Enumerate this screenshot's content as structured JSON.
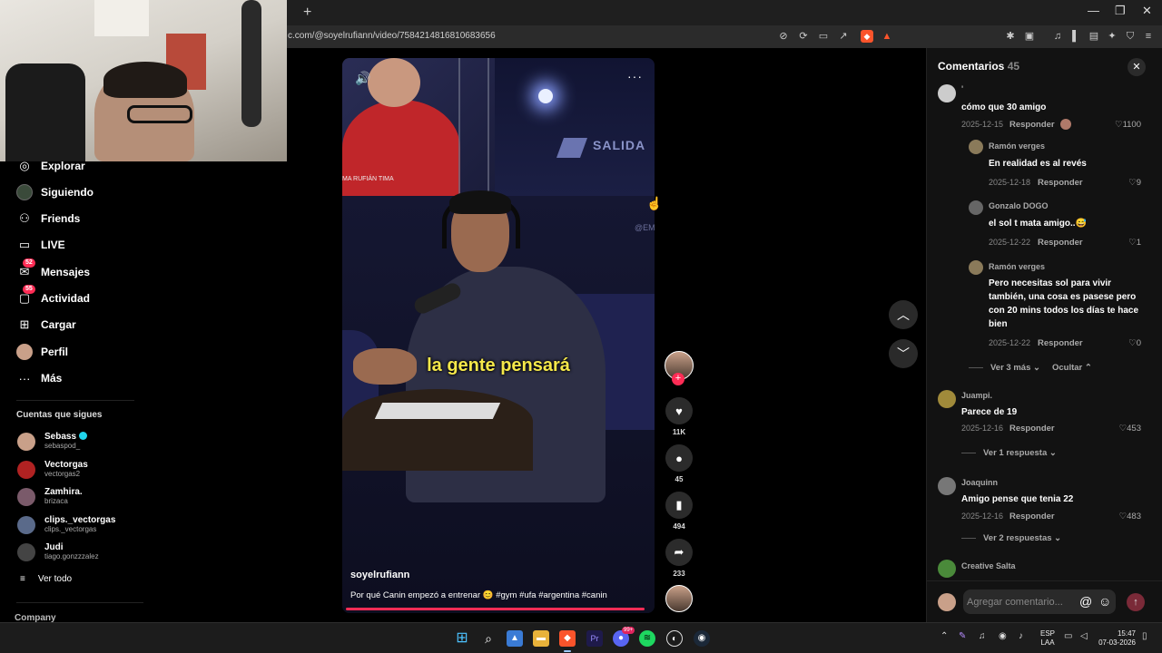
{
  "browser": {
    "url": "c.com/@soyelrufiann/video/7584214816810683656",
    "new_tab": "+",
    "window_controls": [
      "—",
      "❐",
      "✕"
    ]
  },
  "nav": {
    "items": [
      {
        "label": "Explorar",
        "icon": "compass-icon",
        "glyph": "◎"
      },
      {
        "label": "Siguiendo",
        "icon": "following-avatar-icon",
        "glyph": "●"
      },
      {
        "label": "Friends",
        "icon": "friends-icon",
        "glyph": "⚇"
      },
      {
        "label": "LIVE",
        "icon": "live-tv-icon",
        "glyph": "▭"
      },
      {
        "label": "Mensajes",
        "icon": "messages-icon",
        "glyph": "✉",
        "badge": "52"
      },
      {
        "label": "Actividad",
        "icon": "activity-icon",
        "glyph": "▢",
        "badge": "55"
      },
      {
        "label": "Cargar",
        "icon": "upload-icon",
        "glyph": "⊞"
      },
      {
        "label": "Perfil",
        "icon": "profile-avatar-icon",
        "glyph": "●"
      },
      {
        "label": "Más",
        "icon": "more-dots-icon",
        "glyph": "···"
      }
    ],
    "following_title": "Cuentas que sigues",
    "following": [
      {
        "name": "Sebass",
        "handle": "sebaspod_",
        "verified": true,
        "color": "#c9a089"
      },
      {
        "name": "Vectorgas",
        "handle": "vectorgas2",
        "verified": false,
        "color": "#b02222"
      },
      {
        "name": "Zamhira.",
        "handle": "brizaca",
        "verified": false,
        "color": "#7a5a6a"
      },
      {
        "name": "clips._vectorgas",
        "handle": "clips._vectorgas",
        "verified": false,
        "color": "#5a6a8a"
      },
      {
        "name": "Judi",
        "handle": "tiago.gonzzzalez",
        "verified": false,
        "color": "#444444"
      }
    ],
    "see_all": "Ver todo",
    "company": "Company"
  },
  "video": {
    "caption": "la gente pensará",
    "author": "soyelrufiann",
    "description": "Por qué Canin empezó a entrenar 😊 #gym #ufa #argentina #canin",
    "overlay_brand": "SALIDA",
    "overlay_watermark": "@EM",
    "overlay_small": "MA RUFIÁN TIMA",
    "handle_overlay": "soyelrufian",
    "mute_icon": "🔊",
    "more_icon": "···",
    "progress": 0.98
  },
  "actions": {
    "likes": "11K",
    "comments": "45",
    "saves": "494",
    "shares": "233",
    "follow_plus": "+"
  },
  "comments_panel": {
    "title": "Comentarios",
    "count": "45",
    "close": "✕",
    "comments": [
      {
        "user": "'",
        "text": "cómo que 30 amigo",
        "date": "2025-12-15",
        "reply": "Responder",
        "likes": "1100"
      },
      {
        "user": "Ramón verges",
        "text": "En realidad es al revés",
        "date": "2025-12-18",
        "reply": "Responder",
        "likes": "9"
      },
      {
        "user": "Gonzalo DOGO",
        "text": "el sol t mata amigo..😅",
        "date": "2025-12-22",
        "reply": "Responder",
        "likes": "1"
      },
      {
        "user": "Ramón verges",
        "text": "Pero necesitas sol para vivir también, una cosa es pasese pero con 20 mins todos los días te hace bien",
        "date": "2025-12-22",
        "reply": "Responder",
        "likes": "0"
      },
      {
        "user": "Juampi.",
        "text": "Parece de 19",
        "date": "2025-12-16",
        "reply": "Responder",
        "likes": "453"
      },
      {
        "user": "Joaquinn",
        "text": "Amigo pense que tenia 22",
        "date": "2025-12-16",
        "reply": "Responder",
        "likes": "483"
      },
      {
        "user": "Creative Salta",
        "text": "",
        "date": "",
        "reply": "",
        "likes": ""
      }
    ],
    "see_more_3": "Ver 3 más",
    "hide": "Ocultar",
    "see_1_reply": "Ver 1 respuesta",
    "see_2_replies": "Ver 2 respuestas",
    "input_placeholder": "Agregar comentario...",
    "at_icon": "@",
    "emoji_icon": "☺",
    "send_icon": "↑"
  },
  "taskbar": {
    "lang": "ESP",
    "lang2": "LAA",
    "time": "15:47",
    "date": "07-03-2026",
    "discord_badge": "99+"
  },
  "colors": {
    "accent": "#fe2c55",
    "caption": "#f5e84a",
    "panel": "#121212"
  }
}
